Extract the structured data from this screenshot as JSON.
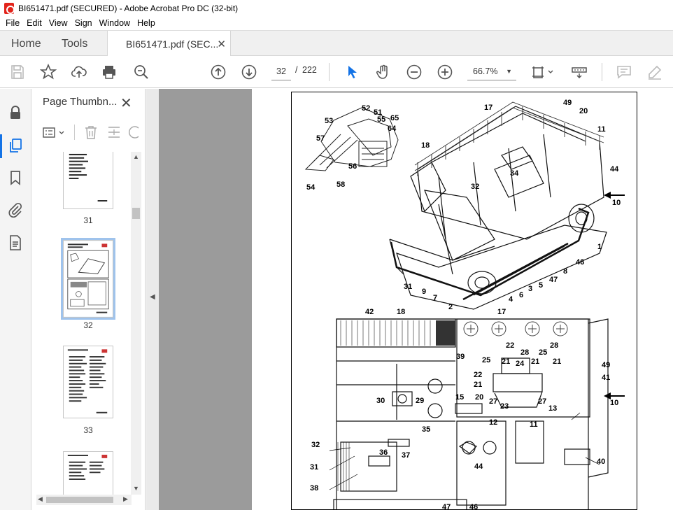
{
  "window": {
    "title": "BI651471.pdf (SECURED) - Adobe Acrobat Pro DC (32-bit)"
  },
  "menu": [
    "File",
    "Edit",
    "View",
    "Sign",
    "Window",
    "Help"
  ],
  "tabs": {
    "home": "Home",
    "tools": "Tools",
    "document": "BI651471.pdf (SEC..."
  },
  "toolbar": {
    "page_current": "32",
    "page_separator": "/",
    "page_total": "222",
    "zoom": "66.7%"
  },
  "thumbnails": {
    "panel_title": "Page Thumbn...",
    "pages": [
      {
        "label": "31"
      },
      {
        "label": "32"
      },
      {
        "label": "33"
      }
    ]
  },
  "document": {
    "callouts_top": [
      "52",
      "51",
      "65",
      "53",
      "55",
      "64",
      "57",
      "56",
      "54",
      "58",
      "17",
      "49",
      "20",
      "11",
      "18",
      "34",
      "44",
      "32",
      "10",
      "1",
      "46",
      "8",
      "47",
      "5",
      "3",
      "31",
      "9",
      "6",
      "4",
      "7",
      "2"
    ],
    "callouts_bottom": [
      "42",
      "18",
      "17",
      "39",
      "22",
      "28",
      "25",
      "21",
      "24",
      "21",
      "22",
      "28",
      "25",
      "21",
      "49",
      "41",
      "21",
      "20",
      "27",
      "23",
      "27",
      "13",
      "10",
      "30",
      "29",
      "15",
      "12",
      "11",
      "35",
      "32",
      "36",
      "37",
      "44",
      "31",
      "40",
      "38",
      "47",
      "46"
    ]
  }
}
